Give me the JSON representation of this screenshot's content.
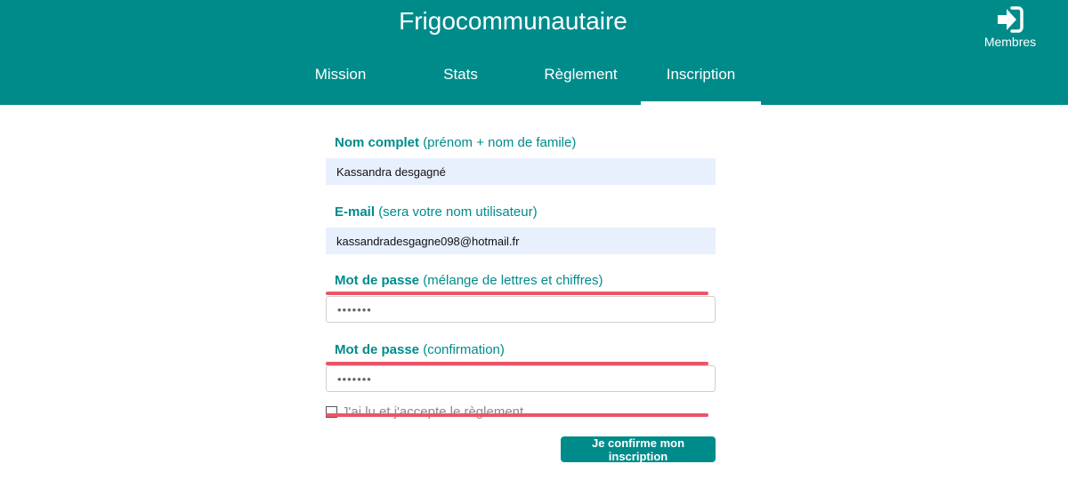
{
  "header": {
    "title": "Frigocommunautaire",
    "members_label": "Membres",
    "members_icon": "sign-in-icon",
    "bg_color": "#008b8b"
  },
  "nav": {
    "tabs": [
      {
        "label": "Mission",
        "active": false
      },
      {
        "label": "Stats",
        "active": false
      },
      {
        "label": "Règlement",
        "active": false
      },
      {
        "label": "Inscription",
        "active": true
      }
    ]
  },
  "form": {
    "full_name": {
      "label_bold": "Nom complet",
      "label_hint": "(prénom +  nom de famile)",
      "value": "Kassandra desgagné"
    },
    "email": {
      "label_bold": "E-mail",
      "label_hint": "(sera votre nom utilisateur)",
      "value": "kassandradesgagne098@hotmail.fr"
    },
    "password": {
      "label_bold": "Mot de passe",
      "label_hint": "(mélange de lettres et chiffres)",
      "value": "•••••••"
    },
    "password_confirm": {
      "label_bold": "Mot de passe",
      "label_hint": "(confirmation)",
      "value": "•••••••"
    },
    "accept_rules": {
      "label": "J'ai lu et j'accepte le règlement",
      "checked": false
    },
    "submit_label": "Je confirme mon inscription",
    "error_color": "#e9566a",
    "accent_color": "#008b8b"
  }
}
